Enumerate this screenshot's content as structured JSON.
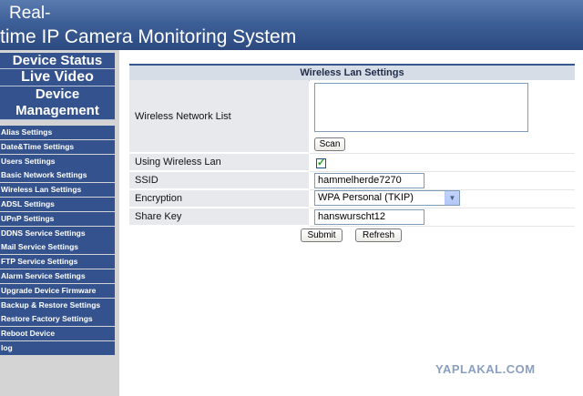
{
  "header": {
    "title_line1": "Real-",
    "title_line2": "time IP Camera Monitoring System"
  },
  "sidebar": {
    "device_status": "Device Status",
    "live_video": "Live Video",
    "device_management_1": "Device",
    "device_management_2": "Management",
    "items": [
      "Alias Settings",
      "Date&Time Settings",
      "Users Settings",
      "Basic Network Settings",
      "Wireless Lan Settings",
      "ADSL Settings",
      "UPnP Settings",
      "DDNS Service Settings",
      "Mail Service Settings",
      "FTP Service Settings",
      "Alarm Service Settings",
      "Upgrade Device Firmware",
      "Backup & Restore Settings",
      "Restore Factory Settings",
      "Reboot Device",
      "log"
    ]
  },
  "panel": {
    "title": "Wireless Lan Settings",
    "labels": {
      "network_list": "Wireless Network List",
      "using_wireless": "Using Wireless Lan",
      "ssid": "SSID",
      "encryption": "Encryption",
      "share_key": "Share Key"
    },
    "scan_label": "Scan",
    "using_wireless_checked": true,
    "ssid_value": "hammelherde7270",
    "encryption_value": "WPA Personal (TKIP)",
    "share_key_value": "hanswurscht12",
    "submit_label": "Submit",
    "refresh_label": "Refresh"
  },
  "icons": {
    "checkmark": "check-icon",
    "dropdown": "chevron-down-icon"
  },
  "watermark": "YAPLAKAL.COM"
}
